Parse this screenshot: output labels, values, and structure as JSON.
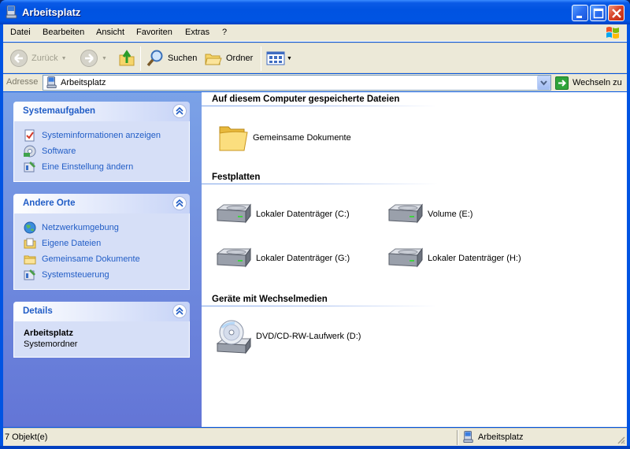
{
  "window": {
    "title": "Arbeitsplatz"
  },
  "menu": {
    "items": [
      "Datei",
      "Bearbeiten",
      "Ansicht",
      "Favoriten",
      "Extras",
      "?"
    ]
  },
  "toolbar": {
    "back_label": "Zurück",
    "search_label": "Suchen",
    "folders_label": "Ordner"
  },
  "address": {
    "label": "Adresse",
    "value": "Arbeitsplatz",
    "go_label": "Wechseln zu"
  },
  "sidebar": {
    "system_tasks": {
      "title": "Systemaufgaben",
      "items": [
        "Systeminformationen anzeigen",
        "Software",
        "Eine Einstellung ändern"
      ]
    },
    "other_places": {
      "title": "Andere Orte",
      "items": [
        "Netzwerkumgebung",
        "Eigene Dateien",
        "Gemeinsame Dokumente",
        "Systemsteuerung"
      ]
    },
    "details": {
      "title": "Details",
      "name": "Arbeitsplatz",
      "type": "Systemordner"
    }
  },
  "content": {
    "stored_files": {
      "heading": "Auf diesem Computer gespeicherte Dateien",
      "items": [
        "Gemeinsame Dokumente"
      ]
    },
    "hard_disks": {
      "heading": "Festplatten",
      "items": [
        "Lokaler Datenträger (C:)",
        "Volume (E:)",
        "Lokaler Datenträger (G:)",
        "Lokaler Datenträger (H:)"
      ]
    },
    "removable": {
      "heading": "Geräte mit Wechselmedien",
      "items": [
        "DVD/CD-RW-Laufwerk (D:)"
      ]
    }
  },
  "status": {
    "left": "7 Objekt(e)",
    "right": "Arbeitsplatz"
  },
  "colors": {
    "titlebar": "#0054e3",
    "sidebar": "#6375d6",
    "link": "#215dc6"
  }
}
